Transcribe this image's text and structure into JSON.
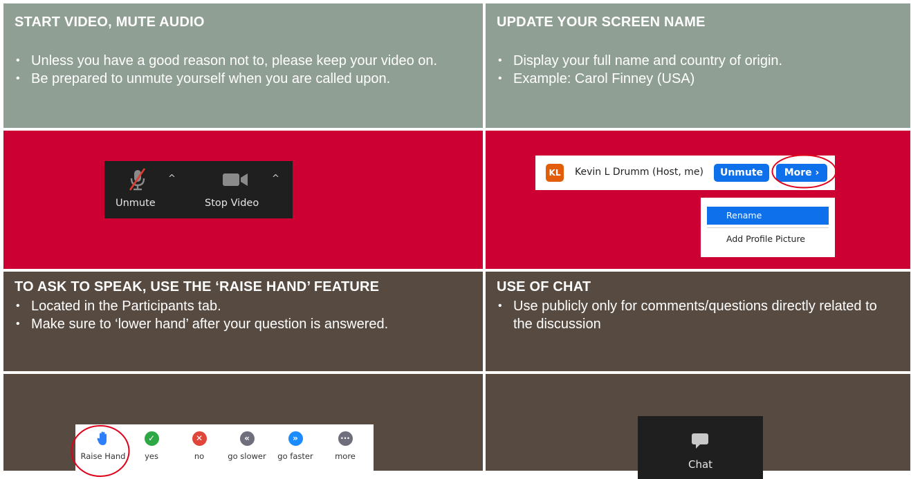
{
  "top_left": {
    "title": "START VIDEO, MUTE AUDIO",
    "bullets": [
      "Unless you have a good reason not to, please keep your video on.",
      "Be prepared to unmute yourself when you are called upon."
    ]
  },
  "top_right": {
    "title": "UPDATE YOUR SCREEN NAME",
    "bullets": [
      "Display your full name and country of origin.",
      "Example: Carol Finney (USA)"
    ]
  },
  "toolbar": {
    "unmute_label": "Unmute",
    "stop_video_label": "Stop Video",
    "caret": "^"
  },
  "participant": {
    "initials": "KL",
    "name": "Kevin L Drumm (Host, me)",
    "unmute_label": "Unmute",
    "more_label": "More ›"
  },
  "more_menu": {
    "items": [
      "Rename",
      "Add Profile Picture"
    ]
  },
  "bottom_left": {
    "title": "TO ASK TO SPEAK, USE THE ‘RAISE HAND’ FEATURE",
    "bullets": [
      "Located in the Participants tab.",
      "Make sure to ‘lower hand’ after your question is answered."
    ]
  },
  "bottom_right": {
    "title": "USE OF CHAT",
    "bullets": [
      "Use publicly only for comments/questions directly related to the discussion"
    ]
  },
  "reactions": {
    "items": [
      {
        "label": "Raise Hand",
        "icon": "hand-icon"
      },
      {
        "label": "yes",
        "icon": "check-icon",
        "color": "#2da845"
      },
      {
        "label": "no",
        "icon": "x-icon",
        "color": "#e0463a"
      },
      {
        "label": "go slower",
        "icon": "rewind-icon",
        "color": "#6e6e7c"
      },
      {
        "label": "go faster",
        "icon": "fast-forward-icon",
        "color": "#1a8cff"
      },
      {
        "label": "more",
        "icon": "ellipsis-icon",
        "color": "#6e6e7c"
      }
    ]
  },
  "chat": {
    "label": "Chat",
    "icon": "chat-bubble-icon"
  },
  "colors": {
    "header_gray": "#909f93",
    "accent_red": "#cc0033",
    "brown": "#574a41",
    "highlight_circle": "#e0001a",
    "zoom_blue": "#0e71eb"
  }
}
